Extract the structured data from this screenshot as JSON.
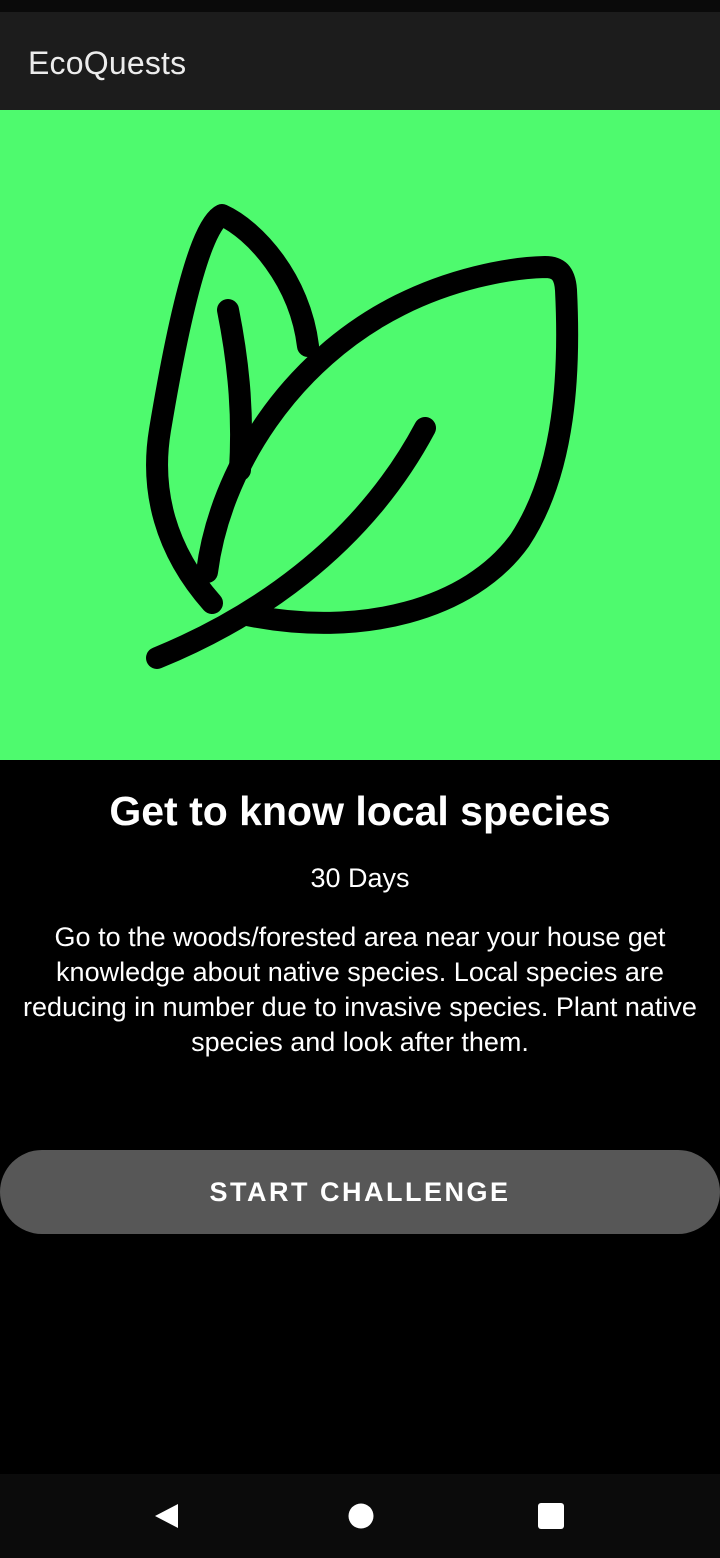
{
  "app": {
    "title": "EcoQuests"
  },
  "hero": {
    "icon": "leaf-icon",
    "background_color": "#4efa6e",
    "icon_color": "#000000"
  },
  "challenge": {
    "title": "Get to know local species",
    "duration": "30 Days",
    "description": "Go to the woods/forested area near your house get knowledge about native species. Local species are reducing in number due to invasive species. Plant native species and look after them."
  },
  "actions": {
    "start_label": "START CHALLENGE",
    "button_color": "#575757"
  },
  "navigation": {
    "back_icon": "back-triangle-icon",
    "home_icon": "home-circle-icon",
    "recents_icon": "recents-square-icon"
  }
}
